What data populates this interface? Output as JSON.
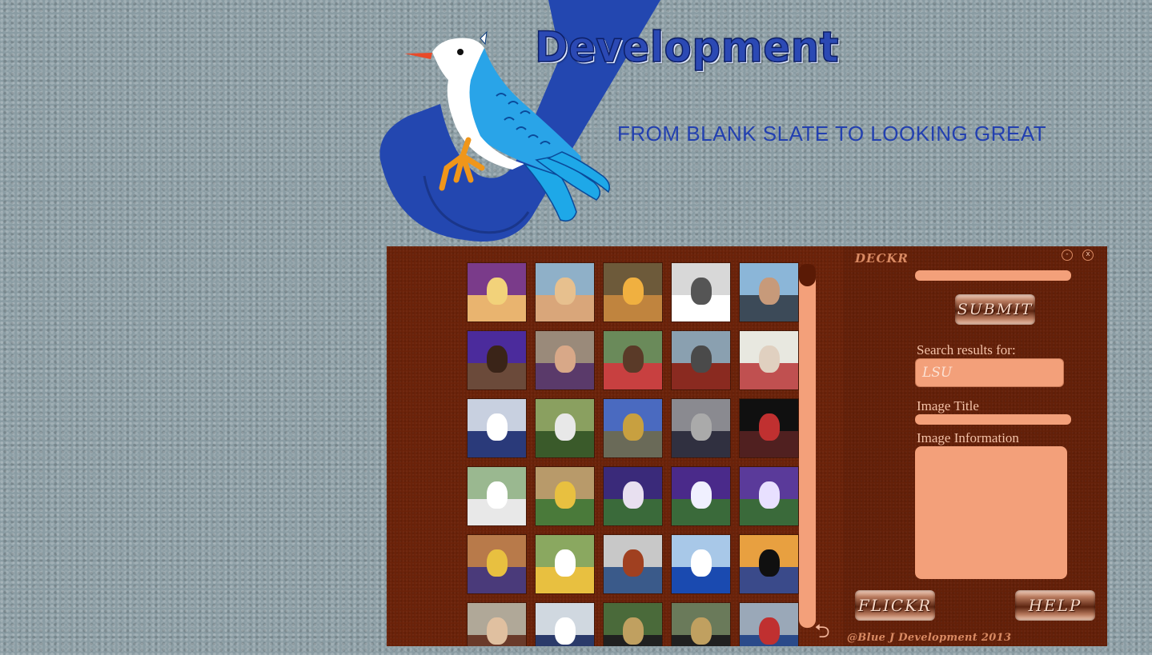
{
  "header": {
    "brand": "Development",
    "tagline": "FROM BLANK SLATE TO LOOKING GREAT"
  },
  "app": {
    "title": "DECKR",
    "window_controls": {
      "minimize": "-",
      "close": "x"
    },
    "search": {
      "value": ""
    },
    "submit_label": "SUBMIT",
    "results_label": "Search results for:",
    "results_value": "LSU",
    "image_title_label": "Image Title",
    "image_title_value": "",
    "image_info_label": "Image Information",
    "image_info_value": "",
    "flickr_label": "FLICKR",
    "help_label": "HELP",
    "copyright": "@Blue J Development 2013",
    "thumbnails": [
      {
        "top": "#7a3b8a",
        "bottom": "#e9b46f",
        "blob": "#f2d27a"
      },
      {
        "top": "#8fb0c8",
        "bottom": "#d9a67a",
        "blob": "#e7c08e"
      },
      {
        "top": "#6d5a3a",
        "bottom": "#c0843e",
        "blob": "#f0b040"
      },
      {
        "top": "#d8d8d8",
        "bottom": "#ffffff",
        "blob": "#555555"
      },
      {
        "top": "#8bb6d8",
        "bottom": "#3c4a58",
        "blob": "#c79a7a"
      },
      {
        "top": "#4b2b9c",
        "bottom": "#6b4a3a",
        "blob": "#3a2418"
      },
      {
        "top": "#9a8a7a",
        "bottom": "#5a3a6a",
        "blob": "#d8a888"
      },
      {
        "top": "#6a8a5a",
        "bottom": "#c84040",
        "blob": "#5a3a28"
      },
      {
        "top": "#8aa0b0",
        "bottom": "#8a2a20",
        "blob": "#4a4a4a"
      },
      {
        "top": "#e8e8e0",
        "bottom": "#c05050",
        "blob": "#e0d0c0"
      },
      {
        "top": "#c8d0e0",
        "bottom": "#2a3a7a",
        "blob": "#ffffff"
      },
      {
        "top": "#8aa060",
        "bottom": "#3a5a2a",
        "blob": "#e8e8e8"
      },
      {
        "top": "#4a6ac0",
        "bottom": "#6a6a58",
        "blob": "#c8a040"
      },
      {
        "top": "#8a8a90",
        "bottom": "#303040",
        "blob": "#aaaaaa"
      },
      {
        "top": "#101010",
        "bottom": "#502020",
        "blob": "#c03030"
      },
      {
        "top": "#9ab890",
        "bottom": "#e8e8e8",
        "blob": "#ffffff"
      },
      {
        "top": "#b89a6a",
        "bottom": "#4a7a3a",
        "blob": "#e8c040"
      },
      {
        "top": "#3a2a7a",
        "bottom": "#3a6a3a",
        "blob": "#e8e0f0"
      },
      {
        "top": "#4a2a8a",
        "bottom": "#3a6a3a",
        "blob": "#f0f0ff"
      },
      {
        "top": "#5a3a9a",
        "bottom": "#3a6a3a",
        "blob": "#e8e0ff"
      },
      {
        "top": "#b87a4a",
        "bottom": "#4a3a7a",
        "blob": "#e8c040"
      },
      {
        "top": "#8aa860",
        "bottom": "#e8c040",
        "blob": "#ffffff"
      },
      {
        "top": "#c8c8c8",
        "bottom": "#3a5a8a",
        "blob": "#a04020"
      },
      {
        "top": "#a8c8e8",
        "bottom": "#1a4ab0",
        "blob": "#ffffff"
      },
      {
        "top": "#e8a040",
        "bottom": "#3a4a8a",
        "blob": "#101010"
      },
      {
        "top": "#b0a898",
        "bottom": "#6a3a2a",
        "blob": "#e0c0a0"
      },
      {
        "top": "#d0d8e0",
        "bottom": "#2a3a6a",
        "blob": "#ffffff"
      },
      {
        "top": "#4a6a3a",
        "bottom": "#202020",
        "blob": "#c0a060"
      },
      {
        "top": "#6a7a5a",
        "bottom": "#202020",
        "blob": "#c0a060"
      },
      {
        "top": "#9aa8b8",
        "bottom": "#2a4a8a",
        "blob": "#c03030"
      }
    ]
  }
}
